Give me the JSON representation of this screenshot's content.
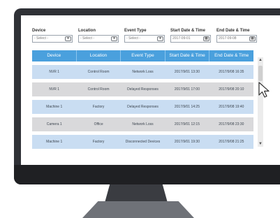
{
  "filters": [
    {
      "label": "Device",
      "value": "- Select -",
      "button": "▾"
    },
    {
      "label": "Location",
      "value": "- Select -",
      "button": "▾"
    },
    {
      "label": "Event Type",
      "value": "- Select -",
      "button": "▾"
    },
    {
      "label": "Start Date & Time",
      "value": "2017-09-01",
      "button": "▦"
    },
    {
      "label": "End Date & Time",
      "value": "2017-09-08",
      "button": "▦"
    }
  ],
  "table": {
    "headers": [
      "Device",
      "Location",
      "Event Type",
      "Start Date & Time",
      "End Date & Time"
    ],
    "rows": [
      [
        "NVR 1",
        "Control Room",
        "Network Loss",
        "2017/9/01  13:30",
        "2017/9/08  16:35"
      ],
      [
        "NVR 1",
        "Control Room",
        "Delayed Responses",
        "2017/9/01  17:00",
        "2017/9/08  20:10"
      ],
      [
        "Machine 1",
        "Factory",
        "Delayed Responses",
        "2017/9/01  14:25",
        "2017/9/08  19:40"
      ],
      [
        "Camera 1",
        "Office",
        "Network Loss",
        "2017/9/01  12:15",
        "2017/9/08  23:30"
      ],
      [
        "Machine 1",
        "Factory",
        "Disconnected Devices",
        "2017/9/01  19:30",
        "2017/9/08  21:25"
      ]
    ]
  },
  "scrollbar": {
    "up": "▲",
    "down": "▼"
  },
  "colors": {
    "header": "#4aa0dd",
    "row_blue": "#c9ddf2",
    "row_gray": "#d9d9db",
    "monitor": "#2f3136"
  }
}
